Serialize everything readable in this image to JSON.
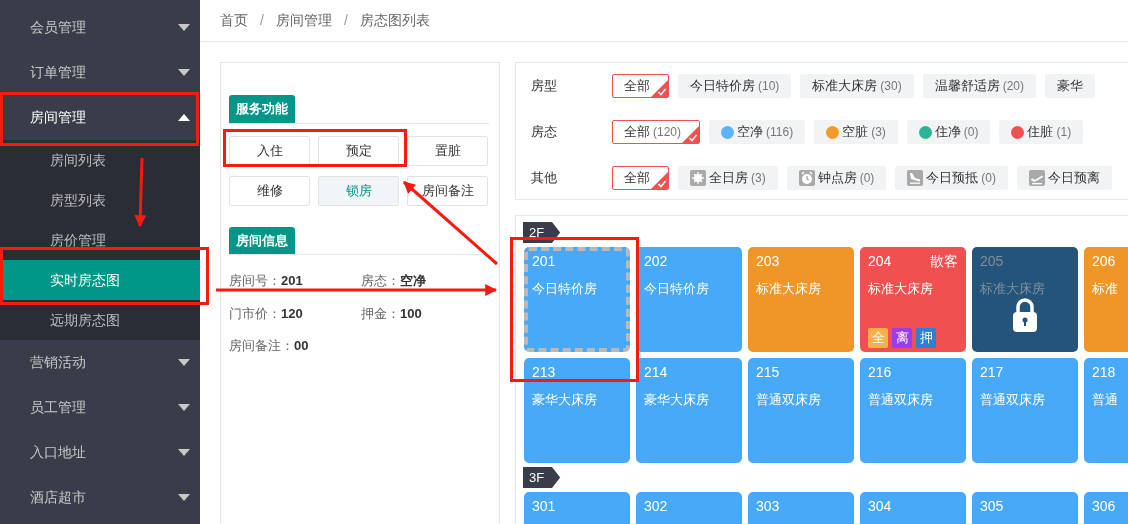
{
  "sidebar": {
    "items": [
      {
        "label": "会员管理",
        "expanded": false
      },
      {
        "label": "订单管理",
        "expanded": false
      },
      {
        "label": "房间管理",
        "expanded": true,
        "children": [
          {
            "label": "房间列表",
            "selected": false
          },
          {
            "label": "房型列表",
            "selected": false
          },
          {
            "label": "房价管理",
            "selected": false
          },
          {
            "label": "实时房态图",
            "selected": true
          },
          {
            "label": "远期房态图",
            "selected": false
          }
        ]
      },
      {
        "label": "营销活动",
        "expanded": false
      },
      {
        "label": "员工管理",
        "expanded": false
      },
      {
        "label": "入口地址",
        "expanded": false
      },
      {
        "label": "酒店超市",
        "expanded": false
      }
    ]
  },
  "breadcrumb": [
    {
      "label": "首页",
      "separator": "/"
    },
    {
      "label": "房间管理",
      "separator": "/"
    },
    {
      "label": "房态图列表"
    }
  ],
  "service_panel": {
    "title": "服务功能",
    "buttons": [
      {
        "label": "入住",
        "selected": false
      },
      {
        "label": "预定",
        "selected": false
      },
      {
        "label": "置脏",
        "selected": false
      },
      {
        "label": "维修",
        "selected": false
      },
      {
        "label": "锁房",
        "selected": true
      },
      {
        "label": "房间备注",
        "selected": false
      }
    ]
  },
  "room_info": {
    "title": "房间信息",
    "fields": [
      "房间号：**201**",
      "房态：**空净**",
      "门市价：**120**",
      "押金：**100**",
      "房间备注：**00**"
    ]
  },
  "filters": [
    {
      "label": "房型",
      "options": [
        {
          "kind": "plain",
          "label": "全部",
          "selected": true
        },
        {
          "kind": "plain",
          "label": "今日特价房",
          "count": "(10)",
          "selected": false
        },
        {
          "kind": "plain",
          "label": "标准大床房",
          "count": "(30)",
          "selected": false
        },
        {
          "kind": "plain",
          "label": "温馨舒适房",
          "count": "(20)",
          "selected": false
        },
        {
          "kind": "plain",
          "label": "豪华",
          "selected": false
        }
      ]
    },
    {
      "label": "房态",
      "options": [
        {
          "kind": "plain",
          "label": "全部",
          "count": "(120)",
          "selected": true
        },
        {
          "kind": "dot",
          "color": "#5cb3f9",
          "label": "空净",
          "count": "(116)",
          "selected": false
        },
        {
          "kind": "dot",
          "color": "#f29b26",
          "label": "空脏",
          "count": "(3)",
          "selected": false
        },
        {
          "kind": "dot",
          "color": "#2bb596",
          "label": "住净",
          "count": "(0)",
          "selected": false
        },
        {
          "kind": "dot",
          "color": "#ef5050",
          "label": "住脏",
          "count": "(1)",
          "selected": false
        }
      ]
    },
    {
      "label": "其他",
      "options": [
        {
          "kind": "plain",
          "label": "全部",
          "selected": true
        },
        {
          "kind": "allday",
          "label": "全日房",
          "count": "(3)",
          "selected": false
        },
        {
          "kind": "hourly",
          "label": "钟点房",
          "count": "(0)",
          "selected": false
        },
        {
          "kind": "arrival",
          "label": "今日预抵",
          "count": "(0)",
          "selected": false
        },
        {
          "kind": "departure",
          "label": "今日预离",
          "selected": false
        }
      ]
    }
  ],
  "floors": [
    {
      "label": "2F",
      "rooms": [
        {
          "number": "201",
          "type": "今日特价房",
          "color": "#47a9f8",
          "selected": true,
          "locked": false
        },
        {
          "number": "202",
          "type": "今日特价房",
          "color": "#47a9f8",
          "selected": false,
          "locked": false
        },
        {
          "number": "203",
          "type": "标准大床房",
          "color": "#f09628",
          "selected": false,
          "locked": false
        },
        {
          "number": "204",
          "type": "标准大床房",
          "color": "#f05050",
          "selected": false,
          "locked": false,
          "guest": "散客",
          "tags": [
            {
              "text": "全",
              "color": "#f7b04a"
            },
            {
              "text": "离",
              "color": "#9a3cf2"
            },
            {
              "text": "押",
              "color": "#2e80d3"
            }
          ]
        },
        {
          "number": "205",
          "type": "标准大床房",
          "color": "#245479",
          "selected": false,
          "locked": true
        },
        {
          "number": "206",
          "type": "标准",
          "color": "#f09628",
          "selected": false,
          "locked": false
        },
        {
          "number": "213",
          "type": "豪华大床房",
          "color": "#47a9f8",
          "selected": false,
          "locked": false
        },
        {
          "number": "214",
          "type": "豪华大床房",
          "color": "#47a9f8",
          "selected": false,
          "locked": false
        },
        {
          "number": "215",
          "type": "普通双床房",
          "color": "#47a9f8",
          "selected": false,
          "locked": false
        },
        {
          "number": "216",
          "type": "普通双床房",
          "color": "#47a9f8",
          "selected": false,
          "locked": false
        },
        {
          "number": "217",
          "type": "普通双床房",
          "color": "#47a9f8",
          "selected": false,
          "locked": false
        },
        {
          "number": "218",
          "type": "普通",
          "color": "#47a9f8",
          "selected": false,
          "locked": false
        }
      ]
    },
    {
      "label": "3F",
      "rooms": [
        {
          "number": "301",
          "color": "#47a9f8",
          "selected": false,
          "locked": false
        },
        {
          "number": "302",
          "color": "#47a9f8",
          "selected": false,
          "locked": false
        },
        {
          "number": "303",
          "color": "#47a9f8",
          "selected": false,
          "locked": false
        },
        {
          "number": "304",
          "color": "#47a9f8",
          "selected": false,
          "locked": false
        },
        {
          "number": "305",
          "color": "#47a9f8",
          "selected": false,
          "locked": false
        },
        {
          "number": "306",
          "color": "#47a9f8",
          "selected": false,
          "locked": false
        }
      ]
    }
  ]
}
